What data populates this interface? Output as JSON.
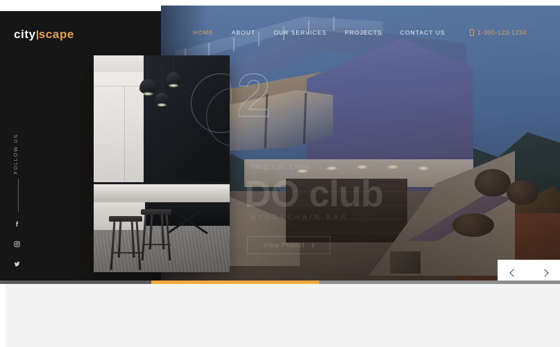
{
  "brand": {
    "name_light": "city",
    "name_accent": "scape",
    "accent_color": "#e8a24a"
  },
  "nav": {
    "items": [
      {
        "label": "HOME",
        "active": true
      },
      {
        "label": "ABOUT",
        "active": false
      },
      {
        "label": "OUR SERVICES",
        "active": false
      },
      {
        "label": "PROJECTS",
        "active": false
      },
      {
        "label": "CONTACT US",
        "active": false
      }
    ]
  },
  "contact": {
    "icon": "phone-icon",
    "phone": "1-300-123-1234",
    "color": "#d9a15e"
  },
  "social": {
    "label": "FOLLOW US",
    "items": [
      {
        "name": "facebook-icon"
      },
      {
        "name": "instagram-icon"
      },
      {
        "name": "twitter-icon"
      }
    ]
  },
  "slide": {
    "number": "02",
    "location": "Hangzhou, China",
    "title": "DO club",
    "subtitle": "BLOCKCHAIN BAR",
    "cta_label": "View Project",
    "cta_icon": "chevron-right-icon"
  },
  "slider_controls": {
    "prev_icon": "chevron-left-icon",
    "next_icon": "chevron-right-icon",
    "progress_start_pct": 27,
    "progress_end_pct": 57,
    "progress_color": "#f0a93c"
  },
  "media": {
    "hero_alt": "modern-house-at-dusk",
    "card_alt": "kitchen-interior-with-pendant-lights"
  }
}
